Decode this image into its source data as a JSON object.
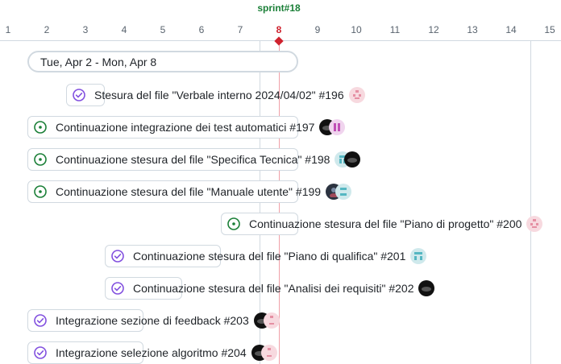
{
  "sprint": {
    "label": "sprint#18"
  },
  "axis": {
    "ticks": [
      "1",
      "2",
      "3",
      "4",
      "5",
      "6",
      "7",
      "8",
      "9",
      "10",
      "11",
      "12",
      "13",
      "14",
      "15"
    ],
    "today": "8"
  },
  "range": {
    "label": "Tue, Apr 2 - Mon, Apr 8"
  },
  "colors": {
    "open": "#1a7f37",
    "closed": "#8250df",
    "today": "#cf222e"
  },
  "items": [
    {
      "title": "Stesura del file \"Verbale interno 2024/04/02\" #196",
      "state": "closed",
      "avatars": [
        "pink-identicon"
      ]
    },
    {
      "title": "Continuazione integrazione dei test automatici #197",
      "state": "open",
      "avatars": [
        "dark-avatar",
        "lavender-identicon"
      ]
    },
    {
      "title": "Continuazione stesura del file \"Specifica Tecnica\" #198",
      "state": "open",
      "avatars": [
        "teal-identicon",
        "dark-avatar"
      ]
    },
    {
      "title": "Continuazione stesura del file \"Manuale utente\" #199",
      "state": "open",
      "avatars": [
        "dark-avatar",
        "teal-identicon"
      ]
    },
    {
      "title": "Continuazione stesura del file \"Piano di progetto\" #200",
      "state": "open",
      "avatars": [
        "pink-identicon"
      ]
    },
    {
      "title": "Continuazione stesura del file \"Piano di qualifica\" #201",
      "state": "closed",
      "avatars": [
        "teal-identicon"
      ]
    },
    {
      "title": "Continuazione stesura del file \"Analisi dei requisiti\" #202",
      "state": "closed",
      "avatars": [
        "dark-avatar"
      ]
    },
    {
      "title": "Integrazione sezione di feedback #203",
      "state": "closed",
      "avatars": [
        "dark-avatar",
        "pink-identicon"
      ]
    },
    {
      "title": "Integrazione selezione algoritmo #204",
      "state": "closed",
      "avatars": [
        "dark-avatar",
        "pink-identicon"
      ]
    }
  ]
}
